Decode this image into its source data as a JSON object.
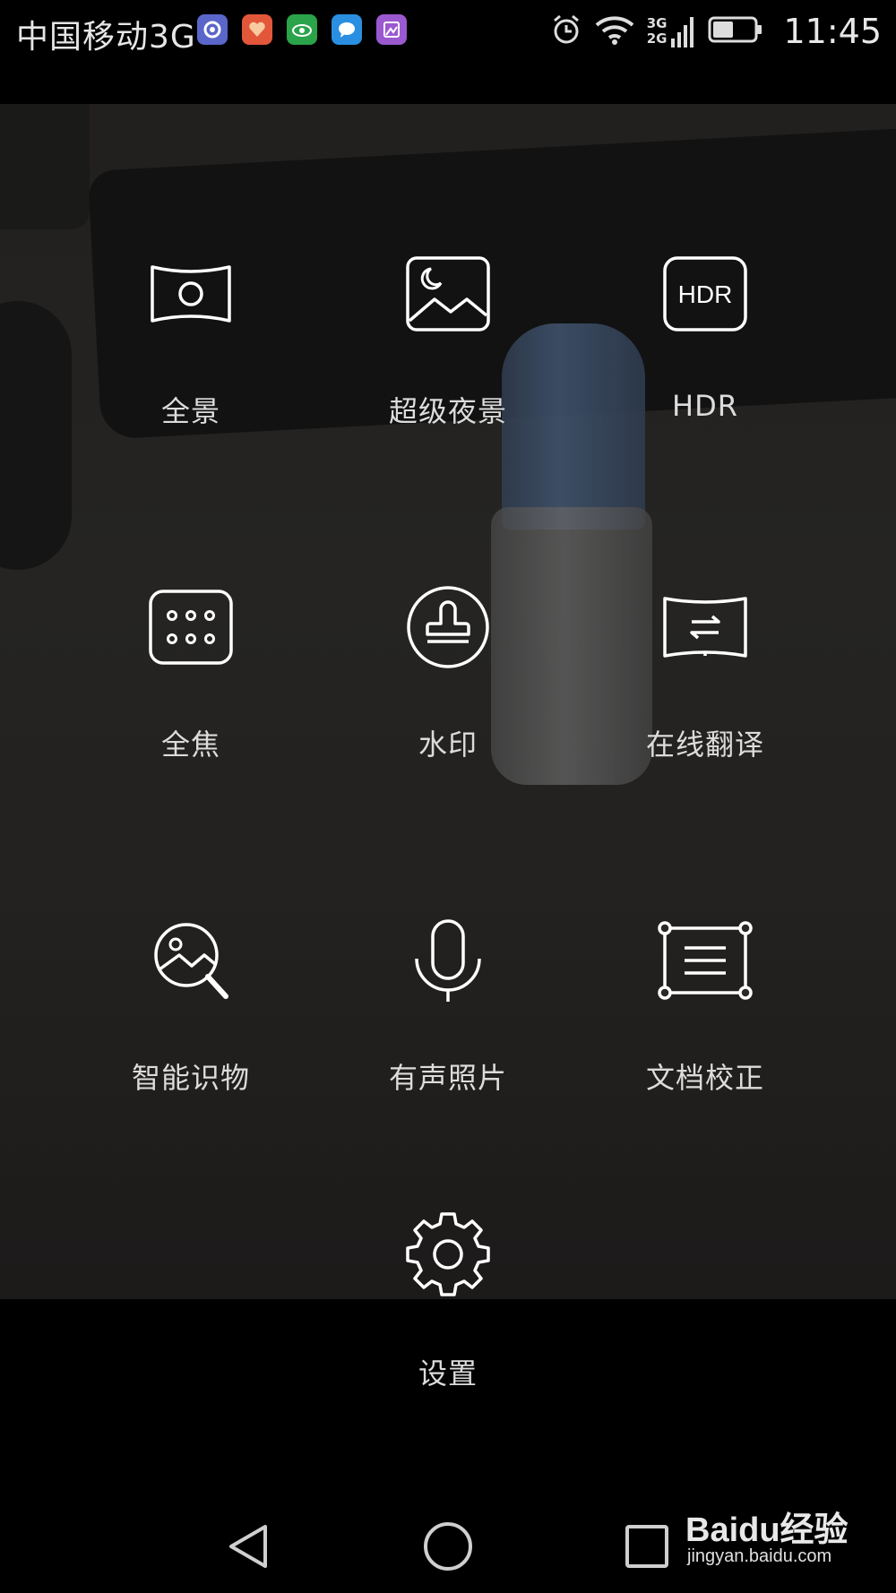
{
  "status_bar": {
    "carrier": "中国移动3G",
    "network_3g": "3G",
    "network_2g": "2G",
    "time": "11:45",
    "notification_icons": [
      "settings-app-icon",
      "health-app-icon",
      "eye-care-icon",
      "message-icon",
      "gallery-icon"
    ]
  },
  "modes": [
    {
      "id": "panorama",
      "label": "全景",
      "icon": "panorama-icon"
    },
    {
      "id": "super-night",
      "label": "超级夜景",
      "icon": "night-scene-icon"
    },
    {
      "id": "hdr",
      "label": "HDR",
      "icon": "hdr-icon",
      "icon_text": "HDR"
    },
    {
      "id": "all-focus",
      "label": "全焦",
      "icon": "all-focus-icon"
    },
    {
      "id": "watermark",
      "label": "水印",
      "icon": "stamp-icon"
    },
    {
      "id": "online-translate",
      "label": "在线翻译",
      "icon": "translate-icon"
    },
    {
      "id": "smart-recognition",
      "label": "智能识物",
      "icon": "image-search-icon"
    },
    {
      "id": "audio-photo",
      "label": "有声照片",
      "icon": "microphone-icon"
    },
    {
      "id": "doc-correction",
      "label": "文档校正",
      "icon": "document-correction-icon"
    }
  ],
  "settings": {
    "label": "设置",
    "icon": "gear-icon"
  },
  "nav_bar": {
    "items": [
      "back-icon",
      "home-icon",
      "recents-icon"
    ]
  },
  "watermark": {
    "brand": "Baidu经验",
    "url": "jingyan.baidu.com"
  }
}
